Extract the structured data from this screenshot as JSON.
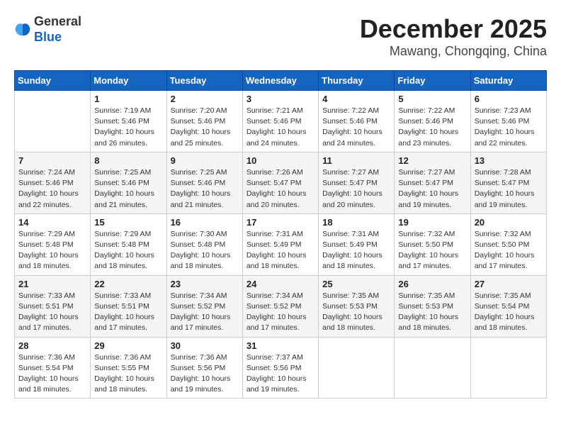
{
  "header": {
    "logo_general": "General",
    "logo_blue": "Blue",
    "month_year": "December 2025",
    "location": "Mawang, Chongqing, China"
  },
  "calendar": {
    "weekdays": [
      "Sunday",
      "Monday",
      "Tuesday",
      "Wednesday",
      "Thursday",
      "Friday",
      "Saturday"
    ],
    "weeks": [
      [
        {
          "day": "",
          "info": ""
        },
        {
          "day": "1",
          "info": "Sunrise: 7:19 AM\nSunset: 5:46 PM\nDaylight: 10 hours\nand 26 minutes."
        },
        {
          "day": "2",
          "info": "Sunrise: 7:20 AM\nSunset: 5:46 PM\nDaylight: 10 hours\nand 25 minutes."
        },
        {
          "day": "3",
          "info": "Sunrise: 7:21 AM\nSunset: 5:46 PM\nDaylight: 10 hours\nand 24 minutes."
        },
        {
          "day": "4",
          "info": "Sunrise: 7:22 AM\nSunset: 5:46 PM\nDaylight: 10 hours\nand 24 minutes."
        },
        {
          "day": "5",
          "info": "Sunrise: 7:22 AM\nSunset: 5:46 PM\nDaylight: 10 hours\nand 23 minutes."
        },
        {
          "day": "6",
          "info": "Sunrise: 7:23 AM\nSunset: 5:46 PM\nDaylight: 10 hours\nand 22 minutes."
        }
      ],
      [
        {
          "day": "7",
          "info": "Sunrise: 7:24 AM\nSunset: 5:46 PM\nDaylight: 10 hours\nand 22 minutes."
        },
        {
          "day": "8",
          "info": "Sunrise: 7:25 AM\nSunset: 5:46 PM\nDaylight: 10 hours\nand 21 minutes."
        },
        {
          "day": "9",
          "info": "Sunrise: 7:25 AM\nSunset: 5:46 PM\nDaylight: 10 hours\nand 21 minutes."
        },
        {
          "day": "10",
          "info": "Sunrise: 7:26 AM\nSunset: 5:47 PM\nDaylight: 10 hours\nand 20 minutes."
        },
        {
          "day": "11",
          "info": "Sunrise: 7:27 AM\nSunset: 5:47 PM\nDaylight: 10 hours\nand 20 minutes."
        },
        {
          "day": "12",
          "info": "Sunrise: 7:27 AM\nSunset: 5:47 PM\nDaylight: 10 hours\nand 19 minutes."
        },
        {
          "day": "13",
          "info": "Sunrise: 7:28 AM\nSunset: 5:47 PM\nDaylight: 10 hours\nand 19 minutes."
        }
      ],
      [
        {
          "day": "14",
          "info": "Sunrise: 7:29 AM\nSunset: 5:48 PM\nDaylight: 10 hours\nand 18 minutes."
        },
        {
          "day": "15",
          "info": "Sunrise: 7:29 AM\nSunset: 5:48 PM\nDaylight: 10 hours\nand 18 minutes."
        },
        {
          "day": "16",
          "info": "Sunrise: 7:30 AM\nSunset: 5:48 PM\nDaylight: 10 hours\nand 18 minutes."
        },
        {
          "day": "17",
          "info": "Sunrise: 7:31 AM\nSunset: 5:49 PM\nDaylight: 10 hours\nand 18 minutes."
        },
        {
          "day": "18",
          "info": "Sunrise: 7:31 AM\nSunset: 5:49 PM\nDaylight: 10 hours\nand 18 minutes."
        },
        {
          "day": "19",
          "info": "Sunrise: 7:32 AM\nSunset: 5:50 PM\nDaylight: 10 hours\nand 17 minutes."
        },
        {
          "day": "20",
          "info": "Sunrise: 7:32 AM\nSunset: 5:50 PM\nDaylight: 10 hours\nand 17 minutes."
        }
      ],
      [
        {
          "day": "21",
          "info": "Sunrise: 7:33 AM\nSunset: 5:51 PM\nDaylight: 10 hours\nand 17 minutes."
        },
        {
          "day": "22",
          "info": "Sunrise: 7:33 AM\nSunset: 5:51 PM\nDaylight: 10 hours\nand 17 minutes."
        },
        {
          "day": "23",
          "info": "Sunrise: 7:34 AM\nSunset: 5:52 PM\nDaylight: 10 hours\nand 17 minutes."
        },
        {
          "day": "24",
          "info": "Sunrise: 7:34 AM\nSunset: 5:52 PM\nDaylight: 10 hours\nand 17 minutes."
        },
        {
          "day": "25",
          "info": "Sunrise: 7:35 AM\nSunset: 5:53 PM\nDaylight: 10 hours\nand 18 minutes."
        },
        {
          "day": "26",
          "info": "Sunrise: 7:35 AM\nSunset: 5:53 PM\nDaylight: 10 hours\nand 18 minutes."
        },
        {
          "day": "27",
          "info": "Sunrise: 7:35 AM\nSunset: 5:54 PM\nDaylight: 10 hours\nand 18 minutes."
        }
      ],
      [
        {
          "day": "28",
          "info": "Sunrise: 7:36 AM\nSunset: 5:54 PM\nDaylight: 10 hours\nand 18 minutes."
        },
        {
          "day": "29",
          "info": "Sunrise: 7:36 AM\nSunset: 5:55 PM\nDaylight: 10 hours\nand 18 minutes."
        },
        {
          "day": "30",
          "info": "Sunrise: 7:36 AM\nSunset: 5:56 PM\nDaylight: 10 hours\nand 19 minutes."
        },
        {
          "day": "31",
          "info": "Sunrise: 7:37 AM\nSunset: 5:56 PM\nDaylight: 10 hours\nand 19 minutes."
        },
        {
          "day": "",
          "info": ""
        },
        {
          "day": "",
          "info": ""
        },
        {
          "day": "",
          "info": ""
        }
      ]
    ]
  }
}
